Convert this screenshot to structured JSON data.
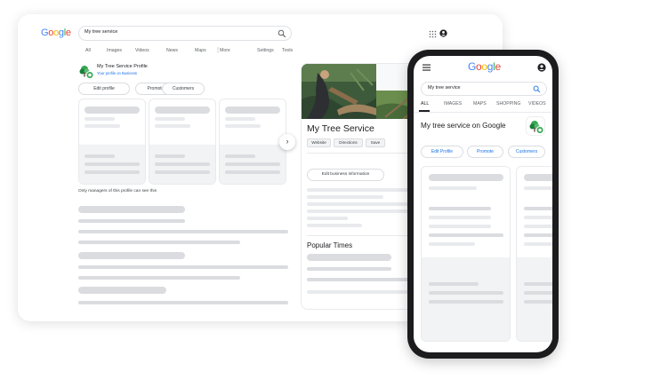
{
  "desktop": {
    "search_value": "My tree service",
    "tabs": [
      "All",
      "Images",
      "Videos",
      "News",
      "Maps",
      "More",
      "Settings",
      "Tools"
    ],
    "profile_title": "My Tree Service Profile",
    "profile_subtitle": "Your profile on Business",
    "actions": [
      "Edit profile",
      "Promote",
      "Customers"
    ],
    "manager_note": "Only managers of this profile can see this",
    "panel": {
      "business_name": "My Tree Service",
      "chips": [
        "Website",
        "Directions",
        "Save"
      ],
      "edit_button": "Edit business information",
      "popular_times": "Popular Times"
    }
  },
  "phone": {
    "search_value": "My tree service",
    "tabs": [
      "ALL",
      "IMAGES",
      "MAPS",
      "SHOPPING",
      "VIDEOS"
    ],
    "heading": "My tree service on Google",
    "actions": [
      "Edit Profile",
      "Promote",
      "Customers"
    ]
  },
  "colors": {
    "google_blue": "#4285F4",
    "google_red": "#EA4335",
    "google_yellow": "#FBBC05",
    "google_green": "#34A853",
    "placeholder": "#dadce0",
    "placeholder_bg": "#f1f3f4"
  },
  "icons": [
    "search-icon",
    "apps-grid-icon",
    "account-icon",
    "chevron-right-icon",
    "hamburger-menu-icon",
    "tree-logo-icon"
  ]
}
